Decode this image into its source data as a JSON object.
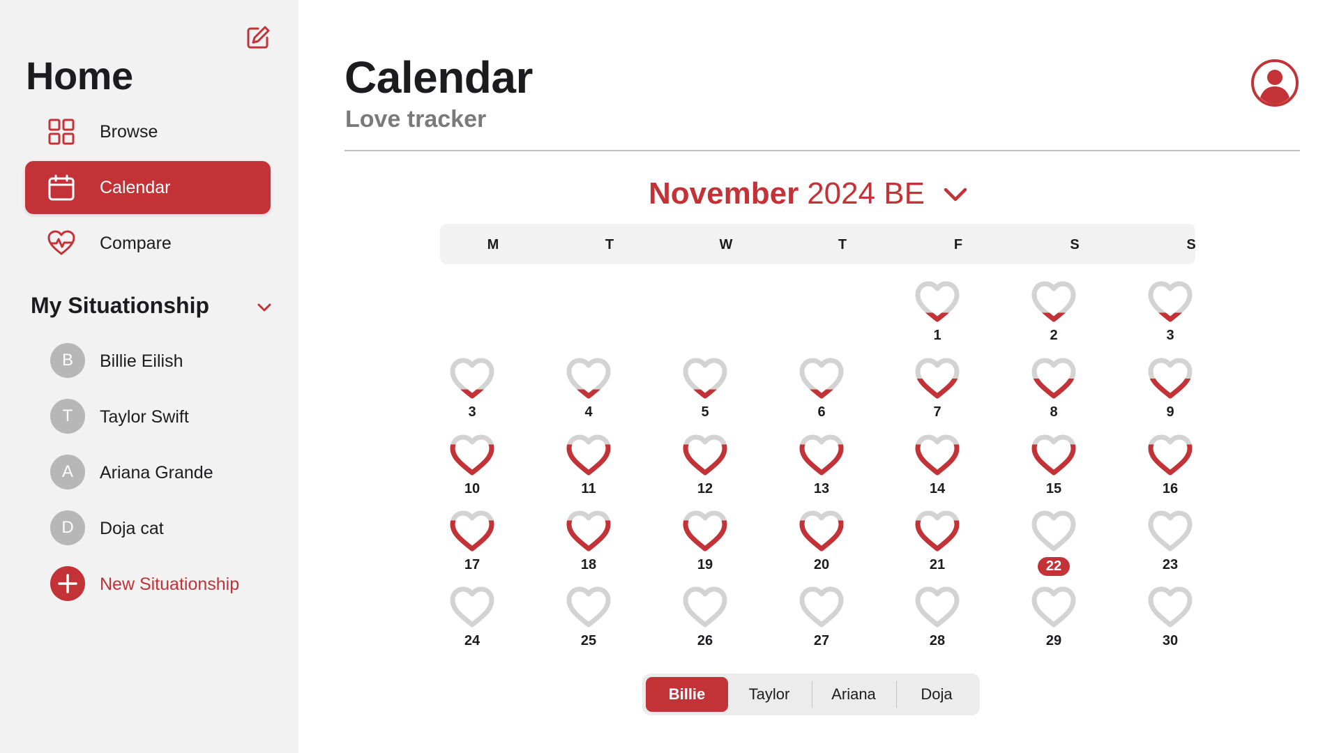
{
  "sidebar": {
    "title": "Home",
    "nav": [
      {
        "label": "Browse",
        "icon": "grid-icon",
        "active": false
      },
      {
        "label": "Calendar",
        "icon": "calendar-icon",
        "active": true
      },
      {
        "label": "Compare",
        "icon": "heart-pulse-icon",
        "active": false
      }
    ],
    "section_title": "My Situationship",
    "people": [
      {
        "initial": "B",
        "name": "Billie Eilish"
      },
      {
        "initial": "T",
        "name": "Taylor Swift"
      },
      {
        "initial": "A",
        "name": "Ariana Grande"
      },
      {
        "initial": "D",
        "name": "Doja cat"
      }
    ],
    "new_label": "New Situationship"
  },
  "header": {
    "title": "Calendar",
    "subtitle": "Love tracker"
  },
  "calendar": {
    "month": "November",
    "year": "2024 BE",
    "weekdays": [
      "M",
      "T",
      "W",
      "T",
      "F",
      "S",
      "S"
    ],
    "weeks": [
      [
        null,
        null,
        null,
        null,
        {
          "label": "1",
          "fill": 0.25
        },
        {
          "label": "2",
          "fill": 0.25
        },
        {
          "label": "3",
          "fill": 0.25
        }
      ],
      [
        {
          "label": "3",
          "fill": 0.25
        },
        {
          "label": "4",
          "fill": 0.25
        },
        {
          "label": "5",
          "fill": 0.25
        },
        {
          "label": "6",
          "fill": 0.25
        },
        {
          "label": "7",
          "fill": 0.5
        },
        {
          "label": "8",
          "fill": 0.5
        },
        {
          "label": "9",
          "fill": 0.5
        }
      ],
      [
        {
          "label": "10",
          "fill": 0.75
        },
        {
          "label": "11",
          "fill": 0.75
        },
        {
          "label": "12",
          "fill": 0.75
        },
        {
          "label": "13",
          "fill": 0.75
        },
        {
          "label": "14",
          "fill": 0.75
        },
        {
          "label": "15",
          "fill": 0.75
        },
        {
          "label": "16",
          "fill": 0.75
        }
      ],
      [
        {
          "label": "17",
          "fill": 0.75
        },
        {
          "label": "18",
          "fill": 0.75
        },
        {
          "label": "19",
          "fill": 0.75
        },
        {
          "label": "20",
          "fill": 0.75
        },
        {
          "label": "21",
          "fill": 0.75
        },
        {
          "label": "22",
          "fill": 0,
          "today": true
        },
        {
          "label": "23",
          "fill": 0
        }
      ],
      [
        {
          "label": "24",
          "fill": 0
        },
        {
          "label": "25",
          "fill": 0
        },
        {
          "label": "26",
          "fill": 0
        },
        {
          "label": "27",
          "fill": 0
        },
        {
          "label": "28",
          "fill": 0
        },
        {
          "label": "29",
          "fill": 0
        },
        {
          "label": "30",
          "fill": 0
        }
      ]
    ]
  },
  "selector": {
    "options": [
      "Billie",
      "Taylor",
      "Ariana",
      "Doja"
    ],
    "active_index": 0
  },
  "colors": {
    "accent": "#c23236",
    "heart_empty": "#d3d3d3",
    "sidebar_bg": "#f2f2f2"
  }
}
